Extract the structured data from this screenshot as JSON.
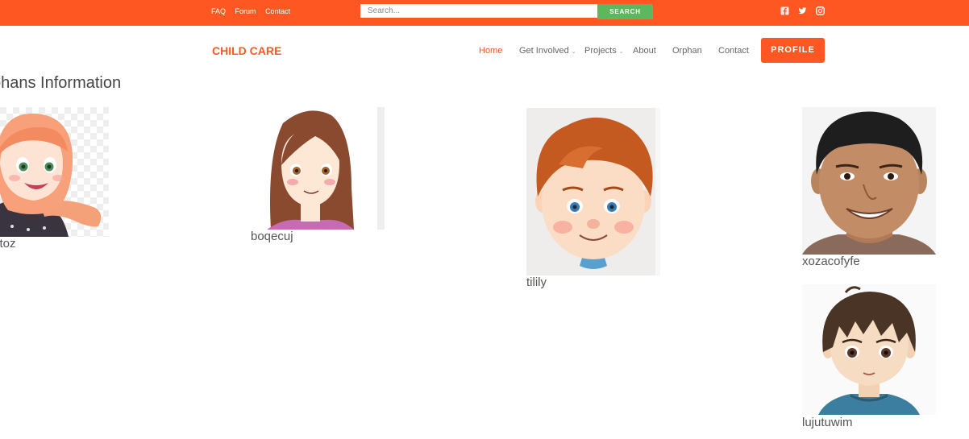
{
  "topbar": {
    "links": [
      "FAQ",
      "Forum",
      "Contact"
    ],
    "search_placeholder": "Search...",
    "search_button": "SEARCH",
    "social": [
      "facebook-icon",
      "twitter-icon",
      "instagram-icon"
    ]
  },
  "navbar": {
    "brand": "CHILD CARE",
    "items": [
      {
        "label": "Home",
        "active": true
      },
      {
        "label": "Get Involved",
        "dropdown": true
      },
      {
        "label": "Projects",
        "dropdown": true
      },
      {
        "label": "About"
      },
      {
        "label": "Orphan"
      },
      {
        "label": "Contact"
      }
    ],
    "profile_button": "PROFILE"
  },
  "page": {
    "title": "phans Information",
    "orphans": [
      {
        "name": "ytoz",
        "avatar": "girl-hijab-avatar"
      },
      {
        "name": "boqecuj",
        "avatar": "girl-long-hair-avatar"
      },
      {
        "name": "tilily",
        "avatar": "boy-red-hair-avatar"
      },
      {
        "name": "xozacofyfe",
        "avatar": "boy-smiling-avatar"
      },
      {
        "name": "lujutuwim",
        "avatar": "boy-anime-avatar"
      }
    ]
  },
  "colors": {
    "accent": "#ff5722",
    "search_button": "#5cb85c",
    "text": "#555555"
  }
}
